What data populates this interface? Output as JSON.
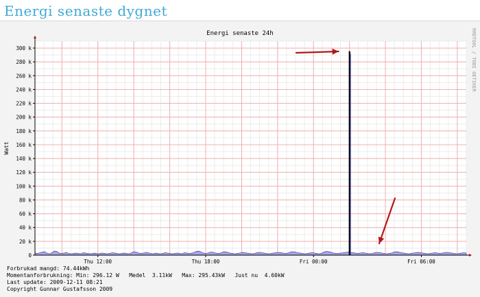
{
  "page": {
    "heading": "Energi senaste dygnet"
  },
  "colors": {
    "background": "#f3f3f3",
    "plot_bg": "#ffffff",
    "grid_minor": "#ececec",
    "grid_major": "#f0b0b0",
    "area_fill": "#a7a6e4",
    "area_line": "#3030a0",
    "spike": "#000000",
    "arrow": "#b01818",
    "heading": "#3fa9d6"
  },
  "chart_data": {
    "type": "area",
    "title": "Energi senaste 24h",
    "ylabel": "Watt",
    "watermark": "RRDTOOL / TOBI OETIKER",
    "ylim": [
      0,
      310000
    ],
    "yticks": [
      0,
      20000,
      40000,
      60000,
      80000,
      100000,
      120000,
      140000,
      160000,
      180000,
      200000,
      220000,
      240000,
      260000,
      280000,
      300000
    ],
    "ytick_labels": [
      "0",
      "20 k",
      "40 k",
      "60 k",
      "80 k",
      "100 k",
      "120 k",
      "140 k",
      "160 k",
      "180 k",
      "200 k",
      "220 k",
      "240 k",
      "260 k",
      "280 k",
      "300 k"
    ],
    "xlim_hours": [
      0,
      24
    ],
    "xticks": [
      {
        "hour": 3.5,
        "label": "Thu 12:00"
      },
      {
        "hour": 9.5,
        "label": "Thu 18:00"
      },
      {
        "hour": 15.5,
        "label": "Fri 00:00"
      },
      {
        "hour": 21.5,
        "label": "Fri 06:00"
      }
    ],
    "series": [
      {
        "values_watt": [
          3000,
          2500,
          3500,
          4500,
          5000,
          3000,
          2000,
          3500,
          6000,
          5500,
          3000,
          2500,
          3000,
          4000,
          2500,
          2000,
          2500,
          3000,
          2500,
          2000,
          3500,
          3000,
          2500,
          2000,
          2500,
          3000,
          2000,
          2500,
          3000,
          2500,
          2000,
          2500,
          3500,
          3000,
          2500,
          2000,
          2500,
          3000,
          2500,
          2000,
          3500,
          5000,
          4500,
          3000,
          2500,
          3000,
          4000,
          3500,
          2500,
          2000,
          3000,
          2500,
          2000,
          2500,
          3500,
          3000,
          2500,
          2000,
          2500,
          3000,
          2500,
          2000,
          3500,
          3000,
          2500,
          3000,
          4000,
          5500,
          6000,
          4500,
          3000,
          2500,
          3500,
          4500,
          4000,
          3000,
          2500,
          3000,
          4500,
          5000,
          4000,
          3000,
          2500,
          2000,
          2500,
          3000,
          4000,
          3500,
          3000,
          2500,
          2000,
          2500,
          3500,
          4000,
          3500,
          3000,
          2500,
          2000,
          2500,
          3000,
          3500,
          4000,
          3500,
          3000,
          2500,
          3000,
          4500,
          5000,
          4500,
          3500,
          3000,
          2500,
          2000,
          2500,
          3000,
          3500,
          3000,
          2500,
          2000,
          3000,
          4500,
          5500,
          5000,
          4000,
          3000,
          2500,
          2500,
          3000,
          3500,
          4000,
          4500,
          4000,
          3500,
          3000,
          2500,
          3000,
          3500,
          3000,
          2500,
          2000,
          2500,
          3500,
          4000,
          3500,
          3000,
          2500,
          2000,
          2500,
          3000,
          4500,
          5000,
          4500,
          3500,
          3000,
          2500,
          2000,
          2500,
          3000,
          3500,
          4000,
          3500,
          3000,
          2500,
          2000,
          2500,
          3000,
          3500,
          3000,
          2500,
          3000,
          3500,
          4000,
          3500,
          3000,
          2500,
          2000,
          2500,
          3000,
          3500,
          3000
        ]
      }
    ],
    "spike": {
      "hour": 17.5,
      "value_watt": 295430
    },
    "annotations": [
      {
        "type": "arrow",
        "label": "arrow pointing to spike top"
      },
      {
        "type": "arrow",
        "label": "arrow pointing to spike base"
      }
    ]
  },
  "stats": {
    "line1": "Forbrukad mangd: 74.44kWh",
    "line2": "Momentanforbrukning: Min: 296.12 W   Medel  3.11kW   Max: 295.43kW   Just nu  4.60kW",
    "line3": "Last update: 2009-12-11 08:21",
    "line4": "Copyright Gunnar Gustafsson 2009"
  }
}
